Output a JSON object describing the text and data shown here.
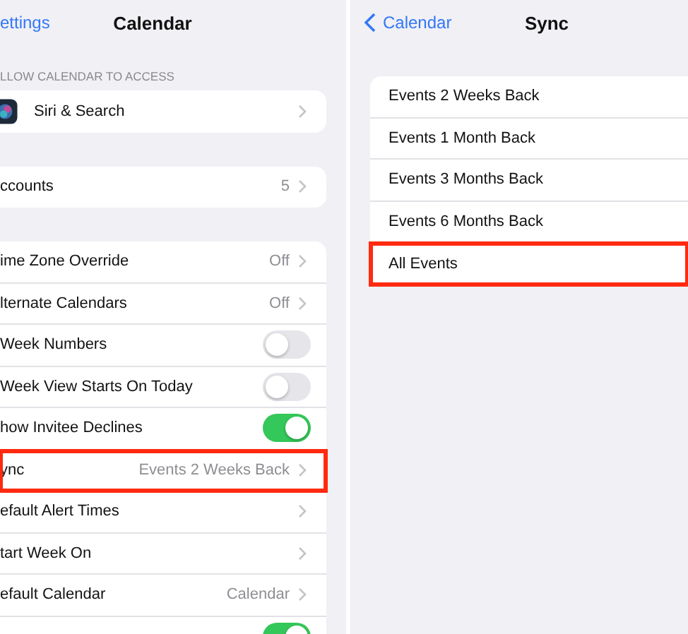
{
  "left": {
    "back": "ettings",
    "title": "Calendar",
    "section_header": "LLOW CALENDAR TO ACCESS",
    "groups": [
      [
        {
          "kind": "chevron",
          "label": "Siri & Search",
          "highlighted": false
        }
      ],
      [
        {
          "kind": "chevron",
          "label": "ccounts",
          "value": "5",
          "highlighted": false
        }
      ],
      [
        {
          "kind": "chevron",
          "label": "ime Zone Override",
          "value": "Off",
          "highlighted": false
        },
        {
          "kind": "chevron",
          "label": "lternate Calendars",
          "value": "Off",
          "highlighted": false
        },
        {
          "kind": "toggle",
          "label": "Week Numbers",
          "on": false,
          "highlighted": false
        },
        {
          "kind": "toggle",
          "label": "Week View Starts On Today",
          "on": false,
          "highlighted": false
        },
        {
          "kind": "toggle",
          "label": "how Invitee Declines",
          "on": true,
          "highlighted": false
        },
        {
          "kind": "chevron",
          "label": "ync",
          "value": "Events 2 Weeks Back",
          "highlighted": true
        },
        {
          "kind": "chevron",
          "label": "efault Alert Times",
          "highlighted": false
        },
        {
          "kind": "chevron",
          "label": "tart Week On",
          "highlighted": false
        },
        {
          "kind": "chevron",
          "label": "efault Calendar",
          "value": "Calendar",
          "highlighted": false
        },
        {
          "kind": "toggle",
          "on": true,
          "highlighted": false
        }
      ]
    ]
  },
  "right": {
    "back": "Calendar",
    "title": "Sync",
    "options": [
      {
        "label": "Events 2 Weeks Back",
        "highlighted": false
      },
      {
        "label": "Events 1 Month Back",
        "highlighted": false
      },
      {
        "label": "Events 3 Months Back",
        "highlighted": false
      },
      {
        "label": "Events 6 Months Back",
        "highlighted": false
      },
      {
        "label": "All Events",
        "highlighted": true
      }
    ]
  }
}
